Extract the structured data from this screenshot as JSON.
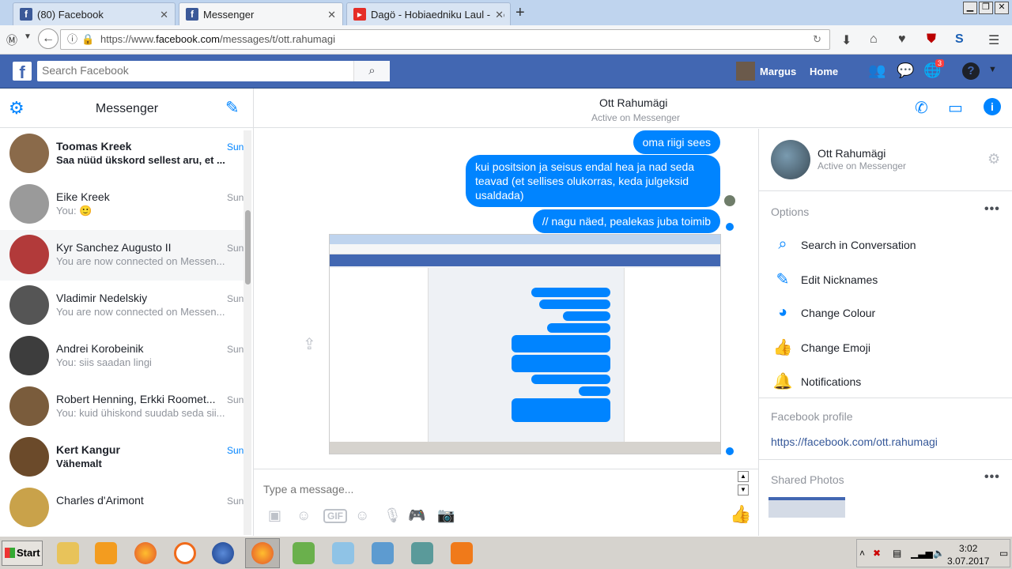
{
  "browser": {
    "tabs": [
      {
        "title": "(80) Facebook",
        "favicon": "facebook-icon"
      },
      {
        "title": "Messenger",
        "favicon": "facebook-icon"
      },
      {
        "title": "Dagö - Hobiaedniku Laul - Yo",
        "favicon": "youtube-icon"
      }
    ],
    "url_prefix": "https://www.",
    "url_domain": "facebook.com",
    "url_path": "/messages/t/ott.rahumagi"
  },
  "facebook": {
    "search_placeholder": "Search Facebook",
    "user_name": "Margus",
    "home_label": "Home",
    "notifications_count": "3"
  },
  "messenger": {
    "title": "Messenger",
    "conversations": [
      {
        "name": "Toomas Kreek",
        "snippet": "Saa nüüd ükskord sellest aru, et ...",
        "time": "Sun",
        "unread": true,
        "color": "#8a6a4a"
      },
      {
        "name": "Eike Kreek",
        "snippet": "You: 🙂",
        "time": "Sun",
        "unread": false,
        "color": "#9a9a9a"
      },
      {
        "name": "Kyr Sanchez Augusto II",
        "snippet": "You are now connected on Messen...",
        "time": "Sun",
        "unread": false,
        "color": "#b23a3a"
      },
      {
        "name": "Vladimir Nedelskiy",
        "snippet": "You are now connected on Messen...",
        "time": "Sun",
        "unread": false,
        "color": "#555555"
      },
      {
        "name": "Andrei Korobeinik",
        "snippet": "You: siis saadan lingi",
        "time": "Sun",
        "unread": false,
        "color": "#3d3d3d"
      },
      {
        "name": "Robert Henning, Erkki Roomet...",
        "snippet": "You: kuid ühiskond suudab seda sii...",
        "time": "Sun",
        "unread": false,
        "color": "#7a5c3c"
      },
      {
        "name": "Kert Kangur",
        "snippet": "Vähemalt",
        "time": "Sun",
        "unread": true,
        "color": "#6b4a2a"
      },
      {
        "name": "Charles d'Arimont",
        "snippet": "",
        "time": "Sun",
        "unread": false,
        "color": "#c9a24a"
      }
    ]
  },
  "chat": {
    "contact_name": "Ott Rahumägi",
    "contact_status": "Active on Messenger",
    "messages": [
      "oma riigi sees",
      "kui positsion ja seisus endal hea ja nad seda teavad (et sellises olukorras, keda julgeksid usaldada)",
      "// nagu näed, pealekas juba toimib"
    ],
    "composer_placeholder": "Type a message..."
  },
  "details": {
    "options_title": "Options",
    "options": [
      {
        "label": "Search in Conversation",
        "icon": "search-icon"
      },
      {
        "label": "Edit Nicknames",
        "icon": "pencil-icon"
      },
      {
        "label": "Change Colour",
        "icon": "palette-icon"
      },
      {
        "label": "Change Emoji",
        "icon": "thumbs-up-icon"
      },
      {
        "label": "Notifications",
        "icon": "bell-icon"
      }
    ],
    "profile_title": "Facebook profile",
    "profile_link": "https://facebook.com/ott.rahumagi",
    "shared_photos_title": "Shared Photos"
  },
  "taskbar": {
    "start_label": "Start",
    "time": "3:02",
    "date": "3.07.2017"
  },
  "colors": {
    "facebook_blue": "#4267b2",
    "messenger_blue": "#0084ff"
  }
}
